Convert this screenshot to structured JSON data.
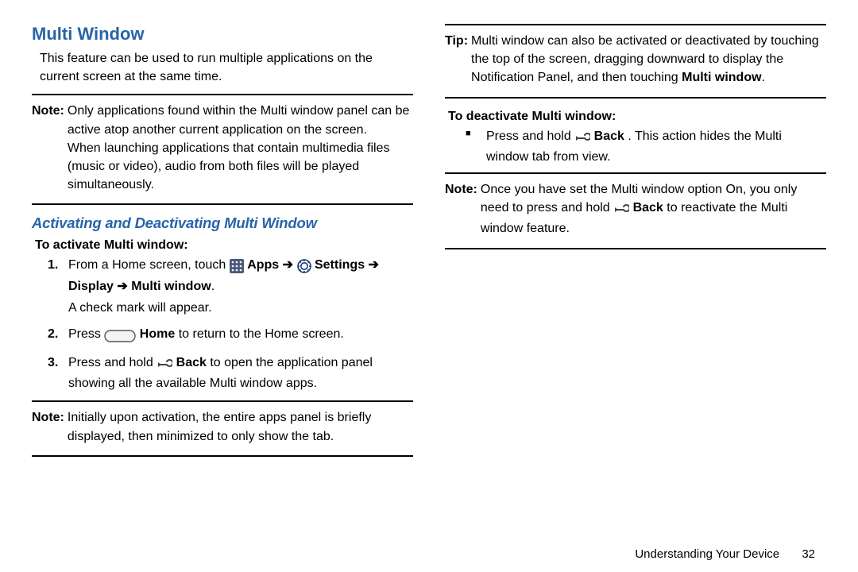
{
  "left": {
    "h1": "Multi Window",
    "intro": "This feature can be used to run multiple applications on the current screen at the same time.",
    "note1_label": "Note:",
    "note1_body": "Only applications found within the Multi window panel can be active atop another current application on the screen.\nWhen launching applications that contain multimedia files (music or video), audio from both files will be played simultaneously.",
    "h2": "Activating and Deactivating Multi Window",
    "activate_heading": "To activate Multi window:",
    "step1_a": "From a Home screen, touch ",
    "step1_apps": "Apps",
    "step1_settings": "Settings",
    "step1_display": "Display",
    "step1_mw": "Multi window",
    "step1_tail": "A check mark will appear.",
    "step2_a": "Press ",
    "step2_home": "Home",
    "step2_b": " to return to the Home screen.",
    "step3_a": "Press and hold ",
    "step3_back": "Back",
    "step3_b": " to open the application panel showing all the available Multi window apps.",
    "note2_label": "Note:",
    "note2_body": "Initially upon activation, the entire apps panel is briefly displayed, then minimized to only show the tab."
  },
  "right": {
    "tip_label": "Tip:",
    "tip_body_a": "Multi window can also be activated or deactivated by touching the top of the screen, dragging downward to display the Notification Panel, and then touching ",
    "tip_mw": "Multi window",
    "deactivate_heading": "To deactivate Multi window:",
    "deact_a": "Press and hold ",
    "deact_back": "Back",
    "deact_b": ". This action hides the Multi window tab from view.",
    "note3_label": "Note:",
    "note3_a": "Once you have set the Multi window option On, you only need to press and hold ",
    "note3_back": "Back",
    "note3_b": " to reactivate the Multi window feature."
  },
  "footer": {
    "section": "Understanding Your Device",
    "page": "32"
  }
}
